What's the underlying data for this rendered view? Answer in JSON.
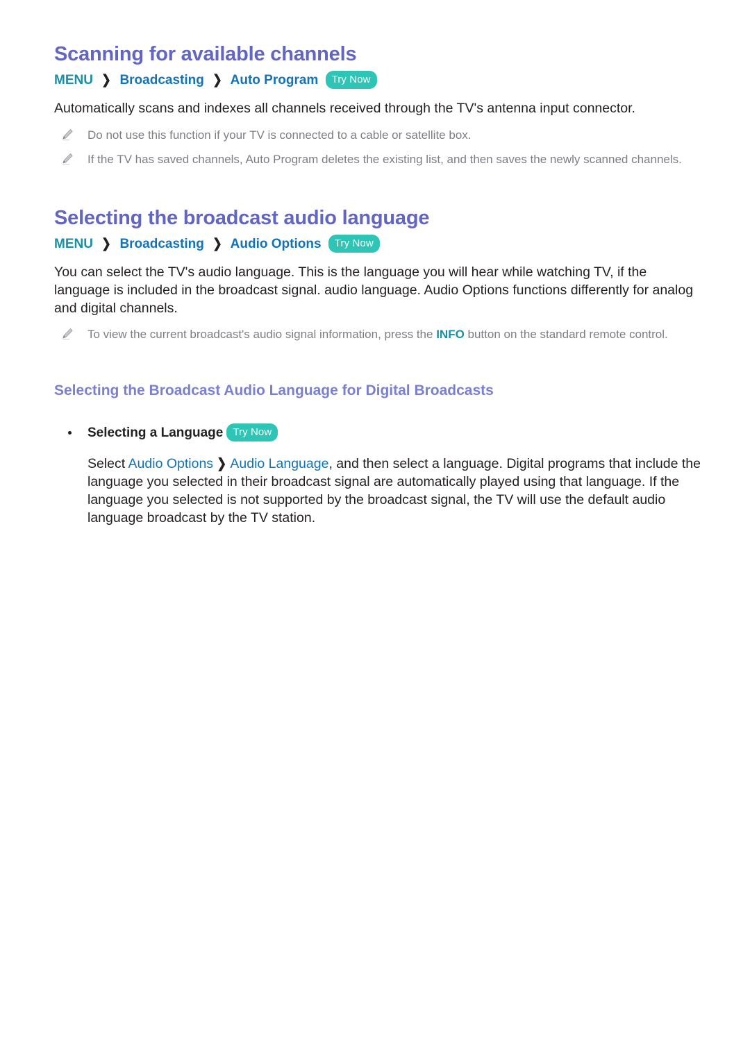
{
  "document": {
    "sections": [
      {
        "id": "scanning-for-available-channels",
        "title": "Scanning for available channels",
        "breadcrumb": {
          "root": "MENU",
          "separator": "❯",
          "items": [
            "Broadcasting",
            "Auto Program"
          ],
          "badge": "Try Now"
        },
        "intro": "Automatically scans and indexes all channels received through the TV's antenna input connector.",
        "notes": [
          "Do not use this function if your TV is connected to a cable or satellite box.",
          "If the TV has saved channels, Auto Program deletes the existing list, and then saves the newly scanned channels."
        ]
      },
      {
        "id": "selecting-the-broadcast-audio-language",
        "title": "Selecting the broadcast audio language",
        "breadcrumb": {
          "root": "MENU",
          "separator": "❯",
          "items": [
            "Broadcasting",
            "Audio Options"
          ],
          "badge": "Try Now"
        },
        "intro": "You can select the TV's audio language. This is the language you will hear while watching TV, if the language is included in the broadcast signal. audio language. Audio Options functions differently for analog and digital channels.",
        "note_info": {
          "before": "To view the current broadcast's audio signal information, press the ",
          "key": "INFO",
          "after": " button on the standard remote control."
        },
        "subsection": {
          "title": "Selecting the Broadcast Audio Language for Digital Broadcasts",
          "bullet": {
            "label": "Selecting a Language",
            "badge": "Try Now"
          },
          "paragraph": {
            "lead": "Select ",
            "link1": "Audio Options",
            "separator": "❯",
            "link2": "Audio Language",
            "rest": ", and then select a language. Digital programs that include the language you selected in their broadcast signal are automatically played using that language. If the language you selected is not supported by the broadcast signal, the TV will use the default audio language broadcast by the TV station."
          }
        }
      }
    ]
  },
  "icons": {
    "note": "pencil-icon",
    "bullet": "bullet-dot-icon"
  },
  "colors": {
    "heading": "#6366c0",
    "subheading": "#7b7fd0",
    "menu_blue": "#1a8fa8",
    "link_blue": "#1273b8",
    "badge_bg": "#2ec4b6",
    "note_gray": "#7d7d85",
    "body_text": "#231f20",
    "page_bg": "#ffffff"
  }
}
